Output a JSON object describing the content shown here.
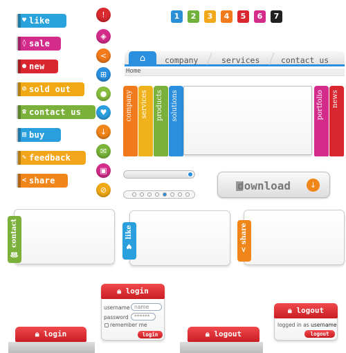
{
  "tags": [
    {
      "label": "like",
      "icon": "♥",
      "color": "#2aa3dd"
    },
    {
      "label": "sale",
      "icon": "◊",
      "color": "#d42c8a"
    },
    {
      "label": "new",
      "icon": "●",
      "color": "#d9262f"
    },
    {
      "label": "sold out",
      "icon": "⊘",
      "color": "#f0a914"
    },
    {
      "label": "contact us",
      "icon": "☎",
      "color": "#7bb03a"
    },
    {
      "label": "buy",
      "icon": "▤",
      "color": "#2a9fde"
    },
    {
      "label": "feedback",
      "icon": "✎",
      "color": "#f2a61b"
    },
    {
      "label": "share",
      "icon": "<",
      "color": "#f0851a"
    }
  ],
  "circles": [
    {
      "icon": "!",
      "color": "#d82a2f"
    },
    {
      "icon": "◈",
      "color": "#d42c8a"
    },
    {
      "icon": "<",
      "color": "#f07a1c"
    },
    {
      "icon": "⊞",
      "color": "#2a8fde"
    },
    {
      "icon": "●",
      "color": "#86bd3e"
    },
    {
      "icon": "♥",
      "color": "#2a9fde"
    },
    {
      "icon": "↓",
      "color": "#f0851a"
    },
    {
      "icon": "✉",
      "color": "#78b43a"
    },
    {
      "icon": "▣",
      "color": "#d42c8a"
    },
    {
      "icon": "⊘",
      "color": "#f0a914"
    }
  ],
  "numbers": [
    {
      "n": "1",
      "color": "#2b8fd8"
    },
    {
      "n": "2",
      "color": "#6fb13a"
    },
    {
      "n": "3",
      "color": "#f2a81b"
    },
    {
      "n": "4",
      "color": "#f07a1c"
    },
    {
      "n": "5",
      "color": "#d9262f"
    },
    {
      "n": "6",
      "color": "#d42c8a"
    },
    {
      "n": "7",
      "color": "#222222"
    }
  ],
  "nav": {
    "tabs": [
      "company",
      "services",
      "contact us"
    ],
    "breadcrumb": "Home"
  },
  "vtabs_left": [
    {
      "label": "company",
      "color": "#f07a1c"
    },
    {
      "label": "services",
      "color": "#f0b21b"
    },
    {
      "label": "products",
      "color": "#7bb03a"
    },
    {
      "label": "solutions",
      "color": "#2a8fde"
    }
  ],
  "vtabs_right": [
    {
      "label": "portfolio",
      "color": "#d42c8a"
    },
    {
      "label": "news",
      "color": "#d9262f"
    }
  ],
  "download": {
    "label": "download"
  },
  "ribbons": [
    {
      "label": "contact",
      "icon": "☎",
      "color": "#7bb03a"
    },
    {
      "label": "like",
      "icon": "♥",
      "color": "#2a9fde"
    },
    {
      "label": "share",
      "icon": "<",
      "color": "#f0851a"
    }
  ],
  "login_form": {
    "title": "login",
    "username_label": "username",
    "username_value": "name",
    "password_label": "password",
    "password_value": "******",
    "remember": "remember me",
    "submit": "login"
  },
  "login_btn": "login",
  "logout_btn": "logout",
  "logout_panel": {
    "title": "logout",
    "logged_in_as": "logged in as",
    "user": "username",
    "submit": "logout"
  }
}
